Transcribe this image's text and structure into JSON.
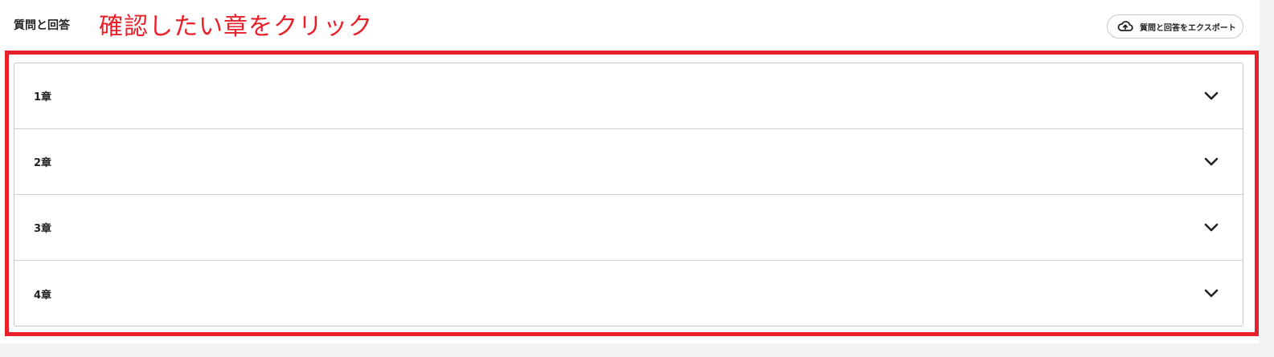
{
  "header": {
    "title": "質問と回答",
    "annotation": "確認したい章をクリック",
    "export_label": "質問と回答をエクスポート"
  },
  "accordion": {
    "items": [
      {
        "label": "1章"
      },
      {
        "label": "2章"
      },
      {
        "label": "3章"
      },
      {
        "label": "4章"
      }
    ]
  },
  "colors": {
    "annotation": "#e8202a",
    "border": "#c8c8c8",
    "background_strip": "#f3f3f6"
  },
  "icons": {
    "export": "cloud-upload-icon",
    "expand": "chevron-down-icon"
  }
}
